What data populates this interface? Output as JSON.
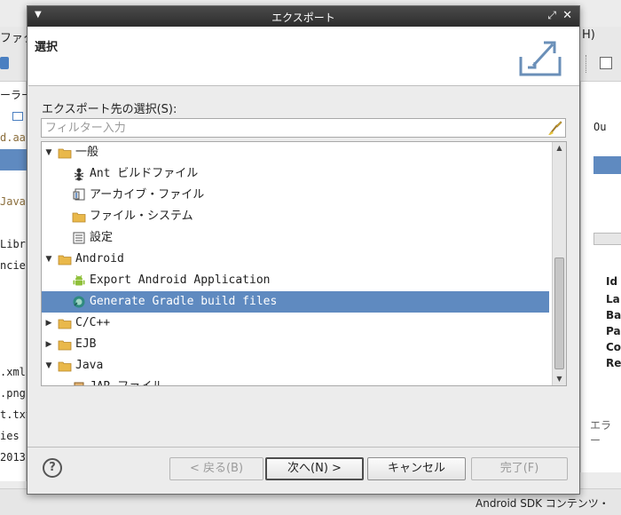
{
  "background_ide": {
    "menubar_fragment": "ファク",
    "menubar_right_fragment": "H)",
    "left_panel_lines": [
      "ーラー",
      "d.aa",
      "Java",
      "Libr",
      "ncies",
      ".xml",
      ".png",
      "t.txt",
      "ies",
      "2013"
    ],
    "right_panel_lines": [
      "Ou",
      "Id",
      "La",
      "Ba",
      "Pa",
      "Co",
      "Re"
    ],
    "bottom_right_fragment": "エラー",
    "statusbar_text": "Android SDK コンテンツ・"
  },
  "dialog": {
    "title": "エクスポート",
    "page_title": "選択",
    "select_label": "エクスポート先の選択(S):",
    "filter": {
      "placeholder": "フィルター入力",
      "value": ""
    },
    "tree": [
      {
        "label": "一般",
        "level": 0,
        "expanded": true,
        "icon": "folder-icon",
        "selected": false
      },
      {
        "label": "Ant ビルドファイル",
        "level": 1,
        "icon": "ant-icon",
        "selected": false
      },
      {
        "label": "アーカイブ・ファイル",
        "level": 1,
        "icon": "archive-icon",
        "selected": false
      },
      {
        "label": "ファイル・システム",
        "level": 1,
        "icon": "folder-icon",
        "selected": false
      },
      {
        "label": "設定",
        "level": 1,
        "icon": "preferences-icon",
        "selected": false
      },
      {
        "label": "Android",
        "level": 0,
        "expanded": true,
        "icon": "folder-icon",
        "selected": false
      },
      {
        "label": "Export Android Application",
        "level": 1,
        "icon": "android-icon",
        "selected": false
      },
      {
        "label": "Generate Gradle build files",
        "level": 1,
        "icon": "gradle-icon",
        "selected": true
      },
      {
        "label": "C/C++",
        "level": 0,
        "expanded": false,
        "icon": "folder-icon",
        "selected": false
      },
      {
        "label": "EJB",
        "level": 0,
        "expanded": false,
        "icon": "folder-icon",
        "selected": false
      },
      {
        "label": "Java",
        "level": 0,
        "expanded": true,
        "icon": "folder-icon",
        "selected": false
      },
      {
        "label": "JAR ファイル",
        "level": 1,
        "icon": "jar-icon",
        "selected": false
      }
    ],
    "buttons": {
      "help": "?",
      "back": "< 戻る(B)",
      "next": "次へ(N) >",
      "cancel": "キャンセル",
      "finish": "完了(F)"
    }
  },
  "colors": {
    "selection": "#5f8ac0",
    "titlebar": "#2d2d2d",
    "folder": "#e9b84a"
  }
}
